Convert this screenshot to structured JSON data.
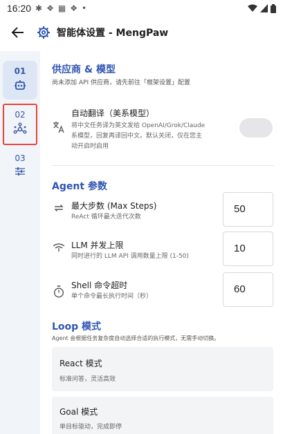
{
  "status_bar": {
    "time": "16:20"
  },
  "app_bar": {
    "title": "智能体设置 - MengPaw"
  },
  "sidebar": {
    "items": [
      {
        "num": "01",
        "icon": "robot-icon"
      },
      {
        "num": "02",
        "icon": "network-icon"
      },
      {
        "num": "03",
        "icon": "sliders-icon"
      }
    ]
  },
  "provider": {
    "title": "供应商 & 模型",
    "desc": "尚未添加 API 供应商，请先前往「框架设置」配置"
  },
  "auto_translate": {
    "title": "自动翻译（美系模型）",
    "desc_line1": "将中文任务译为英文发给 OpenAI/Grok/Claude",
    "desc_line2": "系模型，回复再译回中文。默认关闭，仅在您主",
    "desc_line3": "动开启时启用",
    "enabled": false
  },
  "agent_params": {
    "title": "Agent 参数",
    "max_steps": {
      "title": "最大步数 (Max Steps)",
      "desc": "ReAct 循环最大迭代次数",
      "value": "50"
    },
    "llm_concurrency": {
      "title": "LLM 并发上限",
      "desc": "同时进行的 LLM API 调用数量上限 (1-50)",
      "value": "10"
    },
    "shell_timeout": {
      "title": "Shell 命令超时",
      "desc": "单个命令最长执行时间（秒）",
      "value": "60"
    }
  },
  "loop_mode": {
    "title": "Loop 模式",
    "desc": "Agent 会根据任务复杂度自动选择合适的执行模式，无需手动切换。",
    "modes": [
      {
        "title": "React 模式",
        "desc": "标准问答，灵活高效"
      },
      {
        "title": "Goal 模式",
        "desc": "单目标驱动，完成即停"
      }
    ]
  }
}
